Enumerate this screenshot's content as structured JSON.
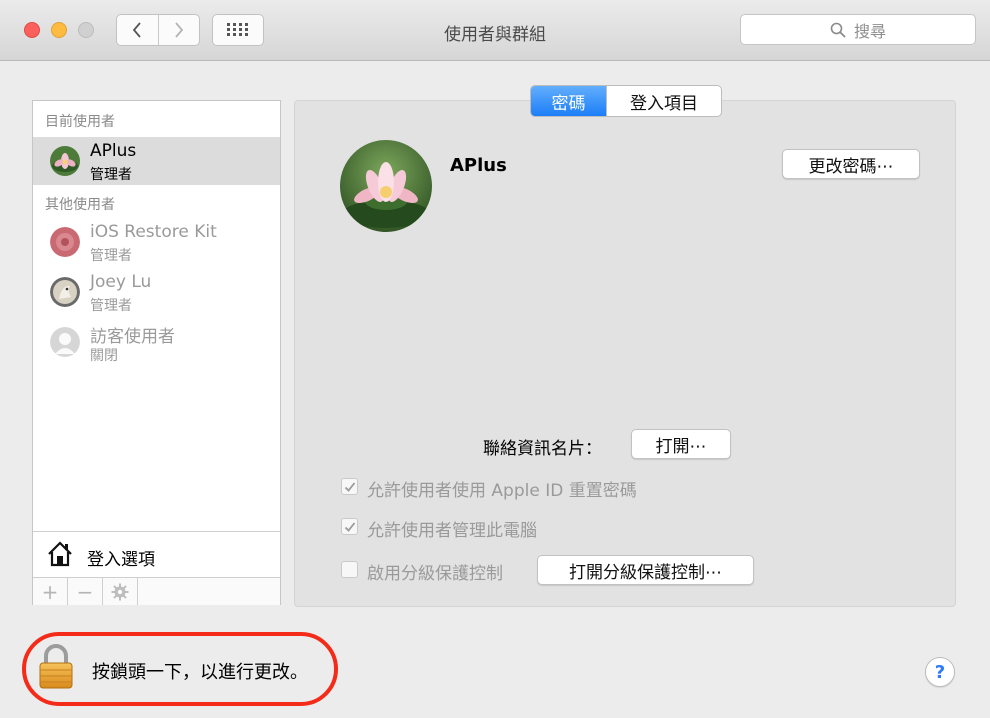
{
  "window": {
    "title": "使用者與群組"
  },
  "search": {
    "placeholder": "搜尋"
  },
  "sidebar": {
    "current_header": "目前使用者",
    "current_user": {
      "name": "APlus",
      "role": "管理者"
    },
    "other_header": "其他使用者",
    "other_users": [
      {
        "name": "iOS Restore Kit",
        "role": "管理者"
      },
      {
        "name": "Joey Lu",
        "role": "管理者"
      },
      {
        "name": "訪客使用者",
        "role": "關閉"
      }
    ],
    "login_options": "登入選項",
    "add_label": "+",
    "remove_label": "−"
  },
  "tabs": [
    {
      "label": "密碼",
      "active": true
    },
    {
      "label": "登入項目",
      "active": false
    }
  ],
  "main": {
    "user_name": "APlus",
    "change_password_button": "更改密碼⋯",
    "contact_card_label": "聯絡資訊名片：",
    "contact_card_button": "打開⋯",
    "checkboxes": [
      {
        "label": "允許使用者使用 Apple ID 重置密碼",
        "checked": true
      },
      {
        "label": "允許使用者管理此電腦",
        "checked": true
      },
      {
        "label": "啟用分級保護控制",
        "checked": false
      }
    ],
    "parental_controls_button": "打開分級保護控制⋯"
  },
  "footer": {
    "lock_text": "按鎖頭一下，以進行更改。",
    "help_label": "?"
  },
  "colors": {
    "accent": "#1c7ef7",
    "highlight_ring": "#f32b18"
  }
}
